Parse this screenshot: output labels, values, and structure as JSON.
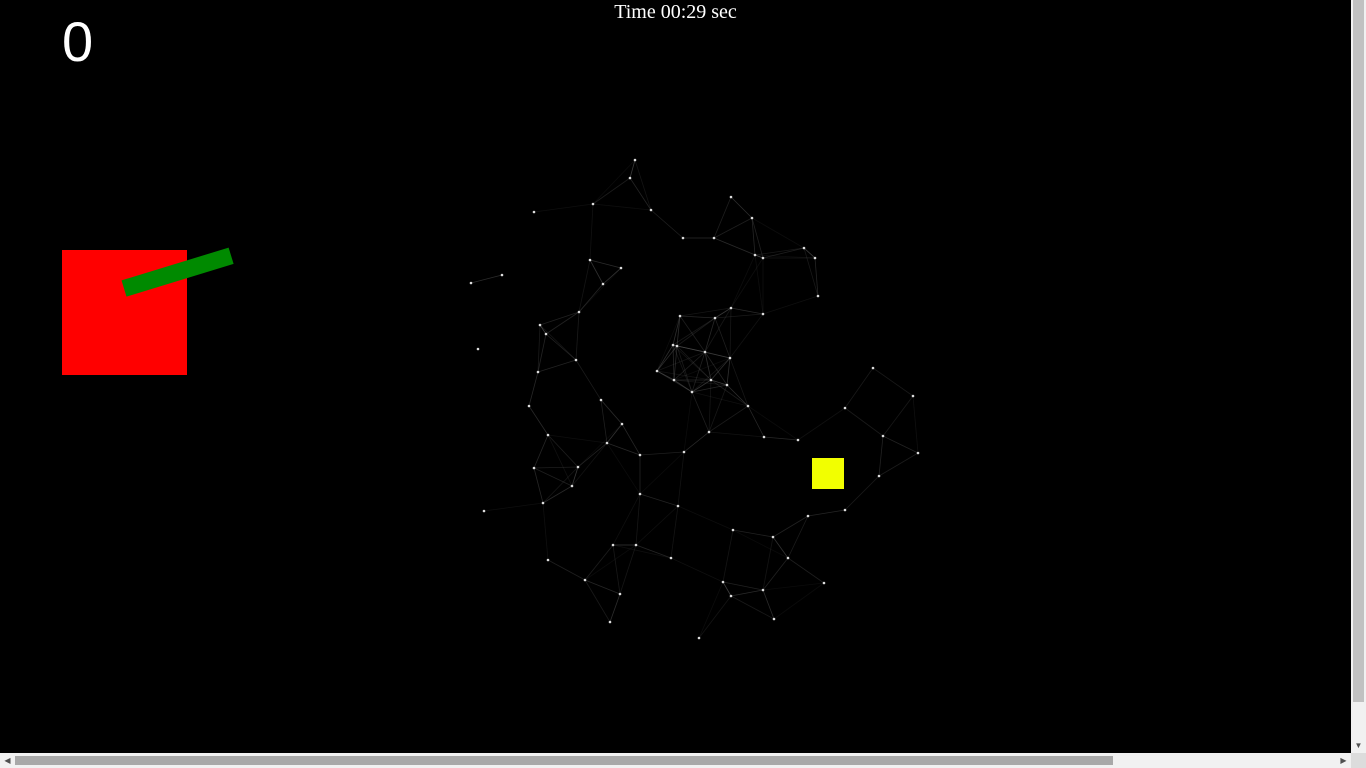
{
  "hud": {
    "score": "0",
    "timer": "Time 00:29 sec"
  },
  "colors": {
    "background": "#000000",
    "player": "#ff0000",
    "turret": "#008a00",
    "target": "#f2ff00",
    "network_line": "#555555",
    "network_node": "#dddddd"
  },
  "icons": {
    "scroll_left": "◀",
    "scroll_right": "▶",
    "scroll_down": "▼"
  }
}
